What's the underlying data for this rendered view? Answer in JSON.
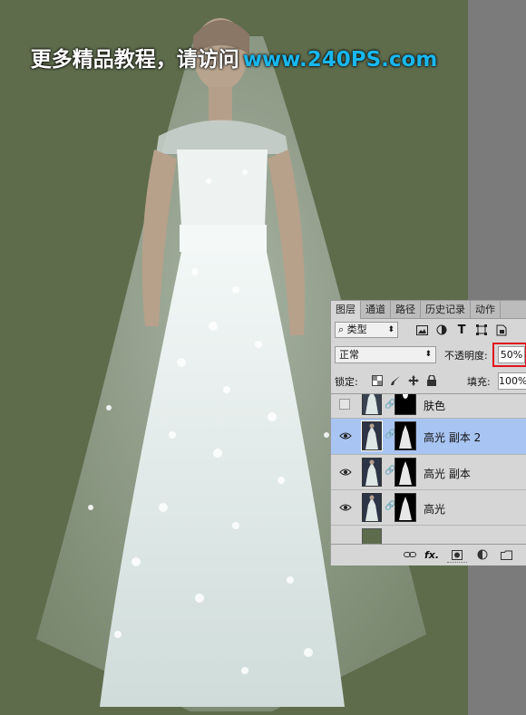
{
  "watermark": {
    "text_cn": "更多精品教程，请访问",
    "url": "www.240PS.com"
  },
  "colors": {
    "canvas_bg": "#5e6c4c",
    "selected_layer": "#a8c4f2",
    "highlight": "#e0141e",
    "watermark_url": "#19b7ee"
  },
  "layers_panel": {
    "tabs": [
      "图层",
      "通道",
      "路径",
      "历史记录",
      "动作"
    ],
    "kind_filter": "类型",
    "filter_icons": [
      "image-filter-icon",
      "adjustment-filter-icon",
      "type-filter-icon",
      "shape-filter-icon",
      "smart-object-filter-icon"
    ],
    "blend_mode": "正常",
    "opacity_label": "不透明度:",
    "opacity_value": "50%",
    "lock_label": "锁定:",
    "fill_label": "填充:",
    "fill_value": "100%",
    "layers": [
      {
        "name": "肤色",
        "visible": false,
        "selected": false
      },
      {
        "name": "高光 副本 2",
        "visible": true,
        "selected": true
      },
      {
        "name": "高光 副本",
        "visible": true,
        "selected": false
      },
      {
        "name": "高光",
        "visible": true,
        "selected": false
      }
    ],
    "footer_icons": [
      "link-layers-icon",
      "fx-icon",
      "add-mask-icon",
      "adjustment-layer-icon",
      "new-group-icon"
    ],
    "fx_label": "fx."
  }
}
